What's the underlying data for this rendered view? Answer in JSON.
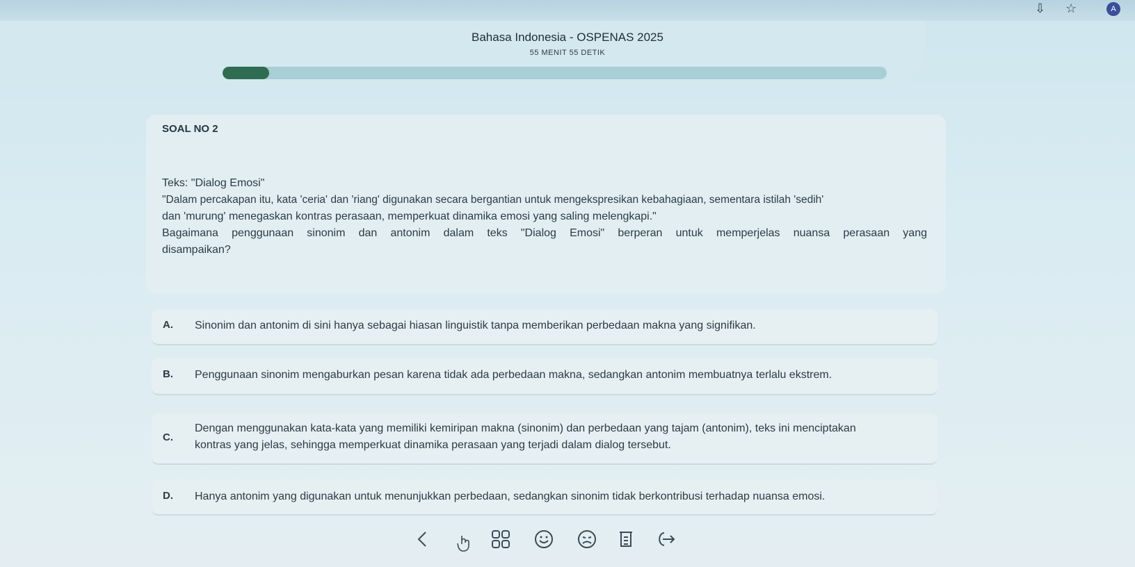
{
  "header": {
    "title": "Bahasa Indonesia - OSPENAS 2025",
    "timer": "55 MENIT 55 DETIK",
    "progress": 0.07
  },
  "question": {
    "number_label": "SOAL NO 2",
    "lines": [
      "Teks: \"Dialog Emosi\"",
      "\"Dalam percakapan itu, kata 'ceria' dan 'riang' digunakan secara bergantian untuk mengekspresikan kebahagiaan, sementara istilah 'sedih'",
      "dan 'murung' menegaskan kontras perasaan, memperkuat dinamika emosi yang saling melengkapi.\"",
      "Bagaimana penggunaan sinonim dan antonim dalam teks \"Dialog Emosi\" berperan untuk memperjelas nuansa perasaan yang",
      "disampaikan?"
    ]
  },
  "options": [
    {
      "letter": "A.",
      "text": "Sinonim dan antonim di sini hanya sebagai hiasan linguistik tanpa memberikan perbedaan makna yang signifikan."
    },
    {
      "letter": "B.",
      "text": "Penggunaan sinonim mengaburkan pesan karena tidak ada perbedaan makna, sedangkan antonim membuatnya terlalu ekstrem."
    },
    {
      "letter": "C.",
      "line1": "Dengan menggunakan kata-kata yang memiliki kemiripan makna (sinonim) dan perbedaan yang tajam (antonim), teks ini menciptakan",
      "line2": "kontras yang jelas, sehingga memperkuat dinamika perasaan yang terjadi dalam dialog tersebut."
    },
    {
      "letter": "D.",
      "text": "Hanya antonim yang digunakan untuk menunjukkan perbedaan, sedangkan sinonim tidak berkontribusi terhadap nuansa emosi."
    }
  ],
  "browser": {
    "avatar_letter": "A"
  },
  "icons": [
    "install-icon",
    "star-icon",
    "prev-icon",
    "grid-icon",
    "happy-icon",
    "sad-icon",
    "list-icon",
    "next-icon",
    "cursor-hand-icon"
  ]
}
